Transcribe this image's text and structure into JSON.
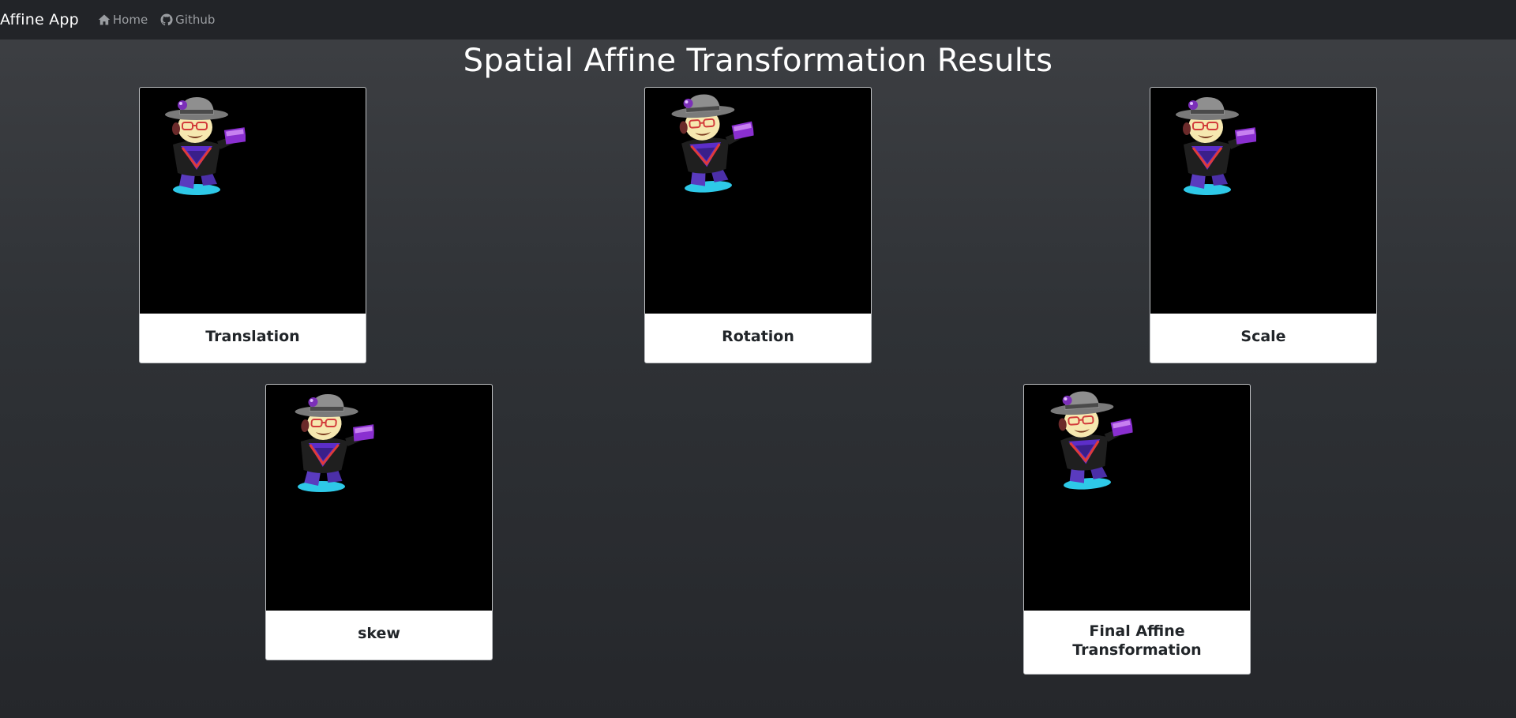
{
  "navbar": {
    "brand": "Affine App",
    "links": [
      {
        "label": "Home",
        "icon": "home-icon"
      },
      {
        "label": "Github",
        "icon": "github-icon"
      }
    ]
  },
  "page": {
    "title": "Spatial Affine Transformation Results"
  },
  "cards": [
    {
      "label": "Translation"
    },
    {
      "label": "Rotation"
    },
    {
      "label": "Scale"
    },
    {
      "label": "skew"
    },
    {
      "label": "Final Affine Transformation"
    }
  ],
  "colors": {
    "navbar_bg": "#222428",
    "page_bg_top": "#3e4044",
    "page_bg_bottom": "#25272b",
    "image_bg": "#000000",
    "accent_cyan": "#2ec9e8",
    "accent_purple": "#6a2fb8"
  }
}
